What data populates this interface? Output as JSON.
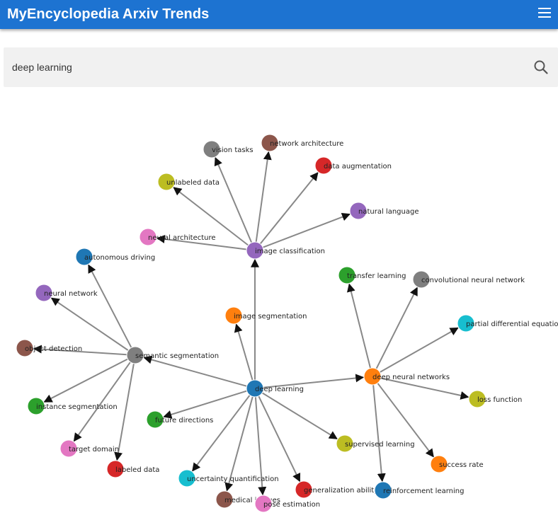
{
  "app": {
    "title": "MyEncyclopedia Arxiv Trends"
  },
  "search": {
    "value": "deep learning"
  },
  "graph": {
    "nodes": [
      {
        "id": "deep-learning",
        "label": "deep learning",
        "color": "#1f77b4"
      },
      {
        "id": "semantic-segmentation",
        "label": "semantic segmentation",
        "color": "#7f7f7f"
      },
      {
        "id": "image-classification",
        "label": "image classification",
        "color": "#9467bd"
      },
      {
        "id": "deep-neural-networks",
        "label": "deep neural networks",
        "color": "#ff7f0e"
      },
      {
        "id": "vision-tasks",
        "label": "vision tasks",
        "color": "#7f7f7f"
      },
      {
        "id": "network-architecture",
        "label": "network architecture",
        "color": "#8c564b"
      },
      {
        "id": "data-augmentation",
        "label": "data augmentation",
        "color": "#d62728"
      },
      {
        "id": "unlabeled-data",
        "label": "unlabeled data",
        "color": "#bcbd22"
      },
      {
        "id": "natural-language",
        "label": "natural language",
        "color": "#9467bd"
      },
      {
        "id": "neural-architecture",
        "label": "neural architecture",
        "color": "#e377c2"
      },
      {
        "id": "autonomous-driving",
        "label": "autonomous driving",
        "color": "#1f77b4"
      },
      {
        "id": "neural-network",
        "label": "neural network",
        "color": "#9467bd"
      },
      {
        "id": "object-detection",
        "label": "object detection",
        "color": "#8c564b"
      },
      {
        "id": "instance-segmentation",
        "label": "instance segmentation",
        "color": "#2ca02c"
      },
      {
        "id": "target-domain",
        "label": "target domain",
        "color": "#e377c2"
      },
      {
        "id": "labeled-data",
        "label": "labeled data",
        "color": "#d62728"
      },
      {
        "id": "image-segmentation",
        "label": "image segmentation",
        "color": "#ff7f0e"
      },
      {
        "id": "future-directions",
        "label": "future directions",
        "color": "#2ca02c"
      },
      {
        "id": "uncertainty-quantification",
        "label": "uncertainty quantification",
        "color": "#17becf"
      },
      {
        "id": "medical-images",
        "label": "medical images",
        "color": "#8c564b"
      },
      {
        "id": "pose-estimation",
        "label": "pose estimation",
        "color": "#e377c2"
      },
      {
        "id": "generalization-ability",
        "label": "generalization ability",
        "color": "#d62728"
      },
      {
        "id": "supervised-learning",
        "label": "supervised learning",
        "color": "#bcbd22"
      },
      {
        "id": "reinforcement-learning",
        "label": "reinforcement learning",
        "color": "#1f77b4"
      },
      {
        "id": "transfer-learning",
        "label": "transfer learning",
        "color": "#2ca02c"
      },
      {
        "id": "convolutional-neural-network",
        "label": "convolutional neural network",
        "color": "#7f7f7f"
      },
      {
        "id": "partial-differential-equation",
        "label": "partial differential equation",
        "color": "#17becf"
      },
      {
        "id": "loss-function",
        "label": "loss function",
        "color": "#bcbd22"
      },
      {
        "id": "success-rate",
        "label": "success rate",
        "color": "#ff7f0e"
      }
    ],
    "edges": [
      [
        "deep-learning",
        "semantic-segmentation"
      ],
      [
        "deep-learning",
        "image-classification"
      ],
      [
        "deep-learning",
        "deep-neural-networks"
      ],
      [
        "deep-learning",
        "image-segmentation"
      ],
      [
        "deep-learning",
        "future-directions"
      ],
      [
        "deep-learning",
        "uncertainty-quantification"
      ],
      [
        "deep-learning",
        "medical-images"
      ],
      [
        "deep-learning",
        "pose-estimation"
      ],
      [
        "deep-learning",
        "generalization-ability"
      ],
      [
        "deep-learning",
        "supervised-learning"
      ],
      [
        "image-classification",
        "vision-tasks"
      ],
      [
        "image-classification",
        "network-architecture"
      ],
      [
        "image-classification",
        "data-augmentation"
      ],
      [
        "image-classification",
        "unlabeled-data"
      ],
      [
        "image-classification",
        "natural-language"
      ],
      [
        "image-classification",
        "neural-architecture"
      ],
      [
        "semantic-segmentation",
        "autonomous-driving"
      ],
      [
        "semantic-segmentation",
        "neural-network"
      ],
      [
        "semantic-segmentation",
        "object-detection"
      ],
      [
        "semantic-segmentation",
        "instance-segmentation"
      ],
      [
        "semantic-segmentation",
        "target-domain"
      ],
      [
        "semantic-segmentation",
        "labeled-data"
      ],
      [
        "deep-neural-networks",
        "transfer-learning"
      ],
      [
        "deep-neural-networks",
        "convolutional-neural-network"
      ],
      [
        "deep-neural-networks",
        "partial-differential-equation"
      ],
      [
        "deep-neural-networks",
        "loss-function"
      ],
      [
        "deep-neural-networks",
        "success-rate"
      ],
      [
        "deep-neural-networks",
        "reinforcement-learning"
      ]
    ]
  }
}
